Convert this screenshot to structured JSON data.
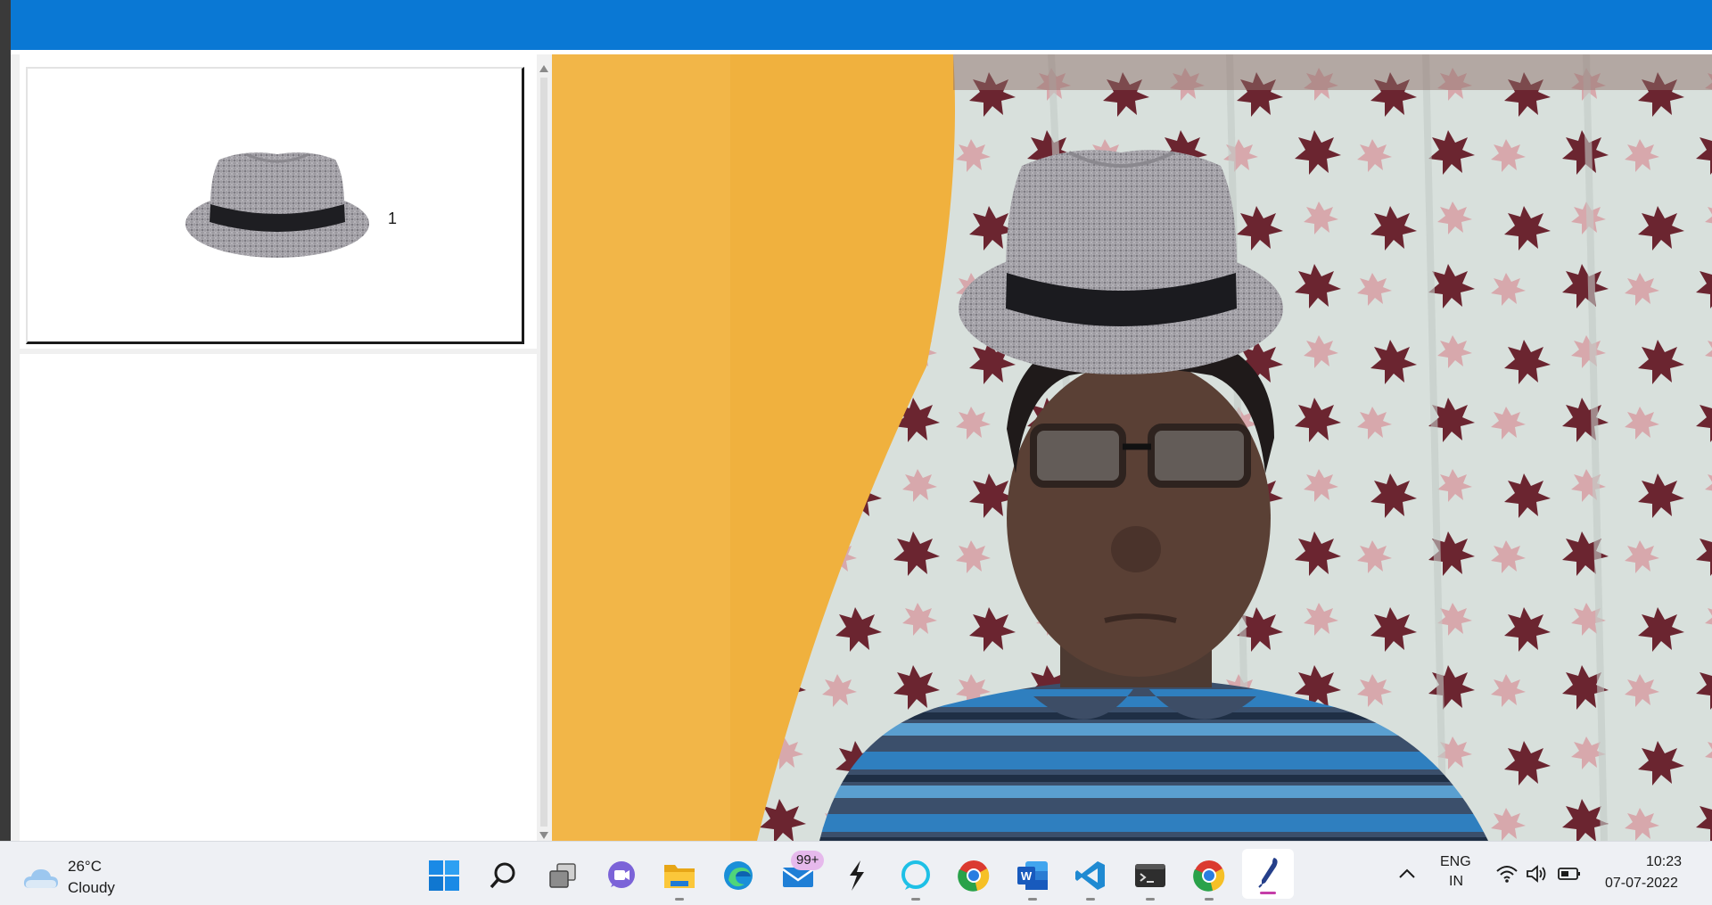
{
  "accessory_list": {
    "items": [
      {
        "index_label": "1",
        "accessory_icon": "fedora-hat-icon"
      }
    ]
  },
  "camera": {
    "overlay_icon": "fedora-hat-icon"
  },
  "taskbar": {
    "weather": {
      "temperature": "26°C",
      "condition": "Cloudy",
      "icon": "cloud-icon"
    },
    "apps": [
      "start-icon",
      "search-icon",
      "task-view-icon",
      "chat-icon",
      "file-explorer-icon",
      "edge-icon",
      "mail-icon",
      "app-bolt-icon",
      "alexa-icon",
      "chrome-icon",
      "word-icon",
      "vscode-icon",
      "terminal-icon",
      "chrome-icon",
      "pen-app-icon"
    ],
    "mail_badge": "99+",
    "tray": {
      "language_line1": "ENG",
      "language_line2": "IN",
      "time": "10:23",
      "date": "07-07-2022"
    }
  },
  "colors": {
    "titlebar": "#0a78d4",
    "wall": "#f2b33d",
    "taskbar": "#eef0f4",
    "badge": "#e6b9ec"
  }
}
